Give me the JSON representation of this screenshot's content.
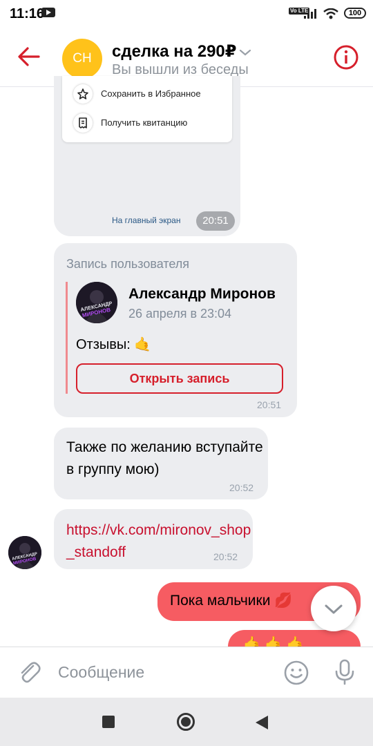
{
  "status_bar": {
    "time": "11:16",
    "network": "Vo LTE",
    "battery": "100"
  },
  "header": {
    "avatar_initials": "СН",
    "title": "сделка на 290₽",
    "subtitle": "Вы вышли из беседы"
  },
  "card_message": {
    "menu_items": [
      {
        "label": "Сохранить в Избранное",
        "icon": "star-icon"
      },
      {
        "label": "Получить квитанцию",
        "icon": "receipt-icon"
      }
    ],
    "main_screen_link": "На главный экран",
    "time": "20:51"
  },
  "repost": {
    "label": "Запись пользователя",
    "author": "Александр Миронов",
    "date": "26 апреля в 23:04",
    "text": "Отзывы: 🤙",
    "open_button": "Открыть запись",
    "time": "20:51",
    "avatar_text": "АЛЕКСАНДР МИРОНОВ"
  },
  "messages": [
    {
      "text": "Также по желанию вступайте в группу мою)",
      "time": "20:52"
    },
    {
      "text": "https://vk.com/mironov_shop_standoff",
      "time": "20:52"
    },
    {
      "text": "Пока мальчики 💋"
    },
    {
      "text": "🤙🤙🤙"
    }
  ],
  "composer": {
    "placeholder": "Сообщение"
  },
  "colors": {
    "accent": "#d61f2b",
    "out_bubble": "#f65c62",
    "in_bubble": "#ecedf0",
    "avatar": "#ffc21a"
  }
}
